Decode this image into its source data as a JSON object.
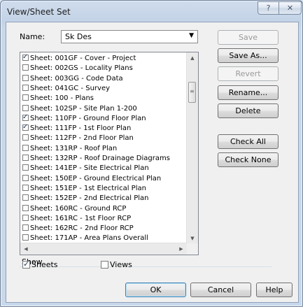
{
  "window": {
    "title": "View/Sheet Set",
    "help_label": "?",
    "close_label": "✕"
  },
  "name_label": "Name:",
  "name_value": "Sk Des",
  "name_arrow": "▼",
  "sheets": [
    {
      "label": "Sheet: 001GF - Cover - Project",
      "checked": true
    },
    {
      "label": "Sheet: 002GS - Locality Plans",
      "checked": false
    },
    {
      "label": "Sheet: 003GG - Code Data",
      "checked": false
    },
    {
      "label": "Sheet: 041GC - Survey",
      "checked": false
    },
    {
      "label": "Sheet: 100 - Plans",
      "checked": false
    },
    {
      "label": "Sheet: 102SP - Site Plan 1-200",
      "checked": false
    },
    {
      "label": "Sheet: 110FP - Ground Floor Plan",
      "checked": true
    },
    {
      "label": "Sheet: 111FP - 1st Floor Plan",
      "checked": true
    },
    {
      "label": "Sheet: 112FP - 2nd Floor Plan",
      "checked": false
    },
    {
      "label": "Sheet: 131RP - Roof Plan",
      "checked": false
    },
    {
      "label": "Sheet: 132RP - Roof Drainage Diagrams",
      "checked": false
    },
    {
      "label": "Sheet: 141EP - Site Electrical Plan",
      "checked": false
    },
    {
      "label": "Sheet: 150EP - Ground Electrical Plan",
      "checked": false
    },
    {
      "label": "Sheet: 151EP - 1st Electrical Plan",
      "checked": false
    },
    {
      "label": "Sheet: 152EP - 2nd Electrical Plan",
      "checked": false
    },
    {
      "label": "Sheet: 160RC - Ground RCP",
      "checked": false
    },
    {
      "label": "Sheet: 161RC - 1st Floor RCP",
      "checked": false
    },
    {
      "label": "Sheet: 162RC - 2nd Floor RCP",
      "checked": false
    },
    {
      "label": "Sheet: 171AP - Area Plans Overall",
      "checked": false
    }
  ],
  "scroll_icons": {
    "up": "▲",
    "down": "▼",
    "left": "◀",
    "right": "▶",
    "grip": "≡"
  },
  "buttons": {
    "save": "Save",
    "save_as": "Save As...",
    "revert": "Revert",
    "rename": "Rename...",
    "delete": "Delete",
    "check_all": "Check All",
    "check_none": "Check None",
    "ok": "OK",
    "cancel": "Cancel",
    "help": "Help"
  },
  "show": {
    "label": "Show",
    "sheets_label": "Sheets",
    "sheets_checked": true,
    "views_label": "Views",
    "views_checked": false
  }
}
